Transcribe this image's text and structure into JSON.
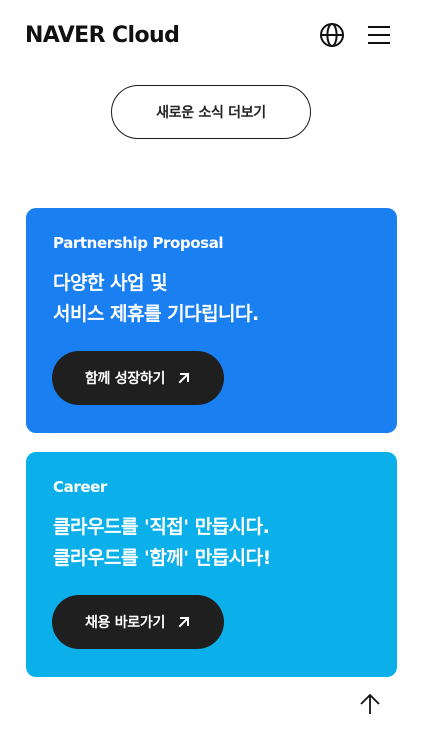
{
  "header": {
    "logo_text": "NAVER Cloud",
    "globe_icon": "globe-icon",
    "menu_icon": "hamburger-menu-icon"
  },
  "news": {
    "more_label": "새로운 소식 더보기"
  },
  "cards": [
    {
      "eyebrow": "Partnership Proposal",
      "headline": [
        "다양한 사업 및",
        "서비스 제휴를 기다립니다."
      ],
      "cta_label": "함께 성장하기",
      "cta_icon": "arrow-up-right-icon",
      "background": "#1a7ff0"
    },
    {
      "eyebrow": "Career",
      "headline": [
        "클라우드를 '직접' 만듭시다.",
        "클라우드를 '함께' 만듭시다!"
      ],
      "cta_label": "채용 바로가기",
      "cta_icon": "arrow-up-right-icon",
      "background": "#0bb0ea"
    }
  ],
  "scroll_top": {
    "icon": "arrow-up-icon"
  },
  "colors": {
    "button_dark": "#1f1f1f",
    "text_dark": "#111111"
  }
}
